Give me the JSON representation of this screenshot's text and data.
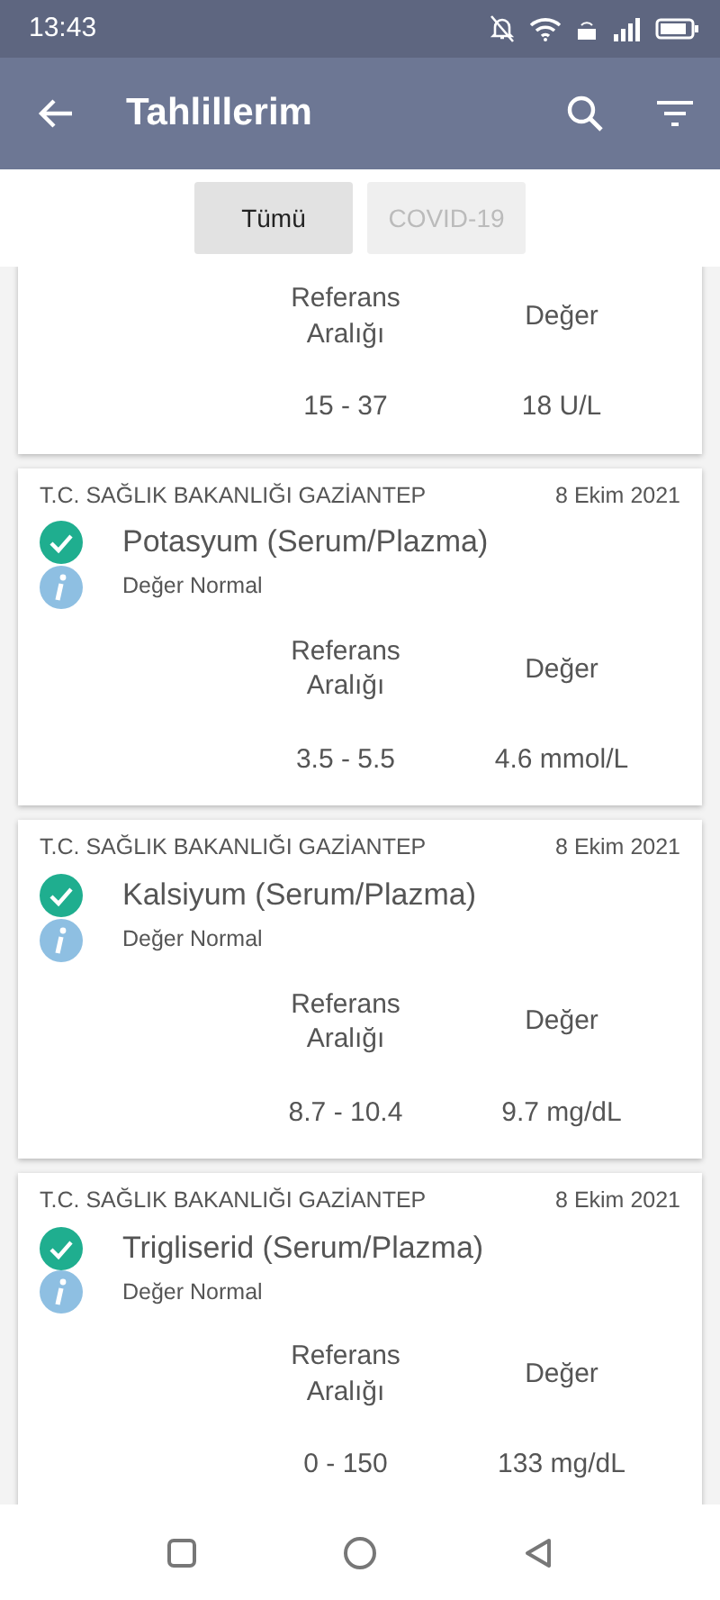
{
  "status_bar": {
    "time": "13:43"
  },
  "app_bar": {
    "title": "Tahlillerim"
  },
  "filters": [
    {
      "label": "Tümü",
      "selected": true
    },
    {
      "label": "COVID-19",
      "selected": false
    }
  ],
  "results": [
    {
      "kind": "partial",
      "range_header": "Referans Aralığı",
      "value_header": "Değer",
      "range": "15 - 37",
      "value": "18 U/L"
    },
    {
      "kind": "full",
      "institution": "T.C. SAĞLIK BAKANLIĞI GAZİANTEP",
      "date": "8 Ekim 2021",
      "test": "Potasyum (Serum/Plazma)",
      "note": "Değer Normal",
      "range_header": "Referans Aralığı",
      "value_header": "Değer",
      "range": "3.5 - 5.5",
      "value": "4.6 mmol/L"
    },
    {
      "kind": "full",
      "institution": "T.C. SAĞLIK BAKANLIĞI GAZİANTEP",
      "date": "8 Ekim 2021",
      "test": "Kalsiyum (Serum/Plazma)",
      "note": "Değer Normal",
      "range_header": "Referans Aralığı",
      "value_header": "Değer",
      "range": "8.7 - 10.4",
      "value": "9.7 mg/dL"
    },
    {
      "kind": "full",
      "institution": "T.C. SAĞLIK BAKANLIĞI GAZİANTEP",
      "date": "8 Ekim 2021",
      "test": "Trigliserid (Serum/Plazma)",
      "note": "Değer Normal",
      "range_header": "Referans Aralığı",
      "value_header": "Değer",
      "range": "0 - 150",
      "value": "133 mg/dL"
    }
  ]
}
